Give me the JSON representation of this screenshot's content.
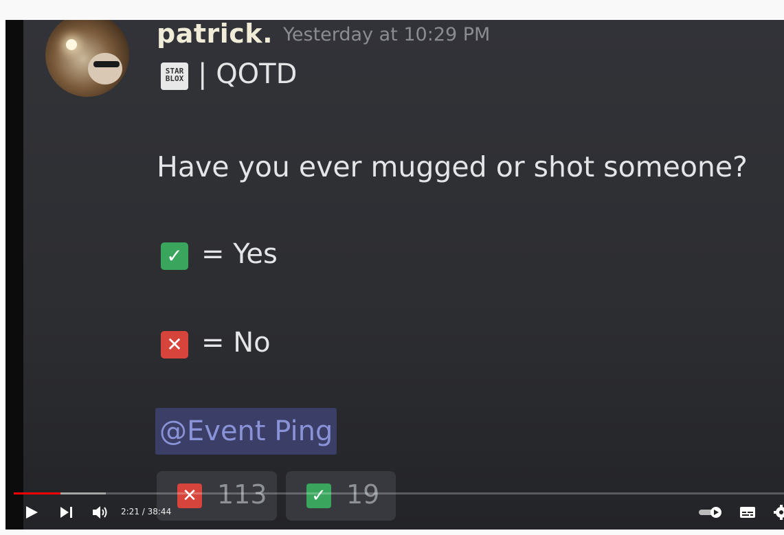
{
  "message": {
    "username": "patrick.",
    "timestamp": "Yesterday at 10:29 PM",
    "server_icon_text": "STAR BLOX",
    "channel_title": "| QOTD",
    "question": "Have you ever mugged or shot someone?",
    "options": [
      {
        "icon": "check-emoji",
        "text": "= Yes"
      },
      {
        "icon": "x-emoji",
        "text": "= No"
      }
    ],
    "mention": "@Event Ping",
    "reactions": [
      {
        "icon": "x-emoji",
        "count": "113"
      },
      {
        "icon": "check-emoji",
        "count": "19"
      }
    ]
  },
  "player": {
    "time": "2:21 / 38:44",
    "progress_fraction": 0.0606,
    "colors": {
      "progress": "#ff0000",
      "check": "#3aa55d",
      "x": "#d7443c",
      "mention_bg": "#3b3e66",
      "mention_text": "#8a93d8"
    }
  }
}
